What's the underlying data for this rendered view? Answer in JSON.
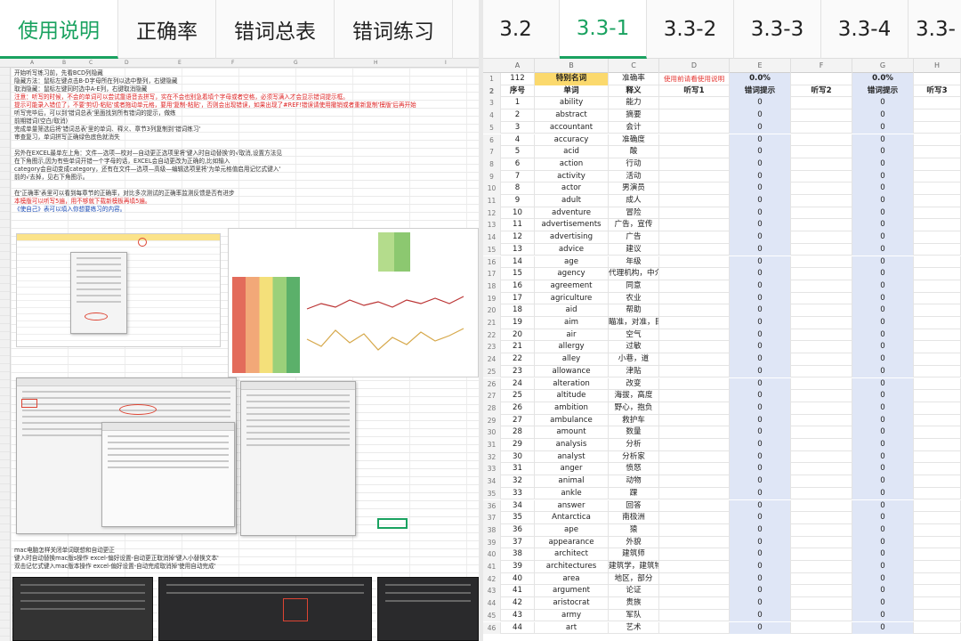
{
  "left_tabs": [
    "使用说明",
    "正确率",
    "错词总表",
    "错词练习"
  ],
  "left_active_tab": 0,
  "left_col_headers": [
    "A",
    "B",
    "C",
    "D",
    "E",
    "F",
    "G",
    "H",
    "I"
  ],
  "instructions": [
    {
      "text": "开始听写练习前，先看BCD列隐藏",
      "color": "normal"
    },
    {
      "text": "隐藏方法：鼠标左键点击B-D字母所在列以选中整列，右键隐藏",
      "color": "normal"
    },
    {
      "text": "取消隐藏：鼠标左键同时选中A-E列，右键取消隐藏",
      "color": "normal"
    },
    {
      "text": "注意：听写的时候，不会的单词可以尝试靠语音去拼写，实在不会也别急着填个字母或者空格，必须写满入才会显示错词提示框。",
      "color": "red"
    },
    {
      "text": "提示可能录入错位了，不要'剪切-粘贴'或者拖动单元格，要用'复制-粘贴'，否则会出现错误，如果出现了#REF!错误请使用撤销或者重新复制'模版'后再开始",
      "color": "red"
    },
    {
      "text": "听写完毕后，可以到'错词总表'里面找到所有错词的提示，做练",
      "color": "normal"
    },
    {
      "text": "前期错词(空白/取消)",
      "color": "normal"
    },
    {
      "text": "完成单量筛选后将'错词总表'里的单词、释义、章节3列复制到'错词练习'",
      "color": "normal"
    },
    {
      "text": "审查复习，单词拼写正确绿色底色就消失",
      "color": "normal"
    },
    {
      "text": "",
      "color": "normal"
    },
    {
      "text": "另外在EXCEL最单左上角：文件—选项—校对—自动更正选项里将'键入时自动替换'的√取消,设置方法见",
      "color": "normal"
    },
    {
      "text": "在下角图示,因为有些单词开错一个字母的话，EXCEL会自动更改为正确的,比如输入",
      "color": "normal"
    },
    {
      "text": "category会自动变成category，还有在文件—选项—高级—编辑选项里将'为单元格值启用记忆式键入'",
      "color": "normal"
    },
    {
      "text": "前的√去掉，见右下角图示。",
      "color": "normal"
    },
    {
      "text": "",
      "color": "normal"
    },
    {
      "text": "在'正确率'表里可以看到每章节的正确率，对比多次测试的正确率监测反馈是否有进步",
      "color": "normal"
    },
    {
      "text": "本模版可以听写5遍，用不够就下载新模板再填5遍。",
      "color": "red"
    },
    {
      "text": "《使自己》表可以填入你想要练习的内容。",
      "color": "blue"
    }
  ],
  "bottom_notes": [
    "mac电脑怎样关闭单词联想和自动更正",
    "键入时自动替换mac版s操作 excel-偏好设置-自动更正取消掉'键入小替换文本'",
    "双击记忆式键入mac版本操作 excel-偏好设置-自动完成取消掉'使用自动完成'"
  ],
  "right_tabs": [
    "3.2",
    "3.3-1",
    "3.3-2",
    "3.3-3",
    "3.3-4",
    "3.3-"
  ],
  "right_active_tab": 1,
  "right_col_headers": [
    "A",
    "B",
    "C",
    "D",
    "E",
    "F",
    "G",
    "H"
  ],
  "sheet_header": {
    "row1": {
      "a": "112",
      "b": "特别名词",
      "c": "准确率",
      "d": "使用前请看使用说明",
      "e": "0.0%",
      "g": "0.0%"
    },
    "row2": {
      "a": "序号",
      "b": "单词",
      "c": "释义",
      "d": "听写1",
      "e": "错词提示",
      "f": "听写2",
      "g": "错词提示",
      "h": "听写3"
    }
  },
  "words": [
    [
      "ability",
      "能力"
    ],
    [
      "abstract",
      "摘要"
    ],
    [
      "accountant",
      "会计"
    ],
    [
      "accuracy",
      "准确度"
    ],
    [
      "acid",
      "酸"
    ],
    [
      "action",
      "行动"
    ],
    [
      "activity",
      "活动"
    ],
    [
      "actor",
      "男演员"
    ],
    [
      "adult",
      "成人"
    ],
    [
      "adventure",
      "冒险"
    ],
    [
      "advertisements",
      "广告，宣传"
    ],
    [
      "advertising",
      "广告"
    ],
    [
      "advice",
      "建议"
    ],
    [
      "age",
      "年级"
    ],
    [
      "agency",
      "代理机构，中介"
    ],
    [
      "agreement",
      "同意"
    ],
    [
      "agriculture",
      "农业"
    ],
    [
      "aid",
      "帮助"
    ],
    [
      "aim",
      "瞄准，对准，目的"
    ],
    [
      "air",
      "空气"
    ],
    [
      "allergy",
      "过敏"
    ],
    [
      "alley",
      "小巷，道"
    ],
    [
      "allowance",
      "津贴"
    ],
    [
      "alteration",
      "改变"
    ],
    [
      "altitude",
      "海拔，高度"
    ],
    [
      "ambition",
      "野心，抱负"
    ],
    [
      "ambulance",
      "救护车"
    ],
    [
      "amount",
      "数量"
    ],
    [
      "analysis",
      "分析"
    ],
    [
      "analyst",
      "分析家"
    ],
    [
      "anger",
      "愤怒"
    ],
    [
      "animal",
      "动物"
    ],
    [
      "ankle",
      "踝"
    ],
    [
      "answer",
      "回答"
    ],
    [
      "Antarctica",
      "南极洲"
    ],
    [
      "ape",
      "猿"
    ],
    [
      "appearance",
      "外貌"
    ],
    [
      "architect",
      "建筑师"
    ],
    [
      "architectures",
      "建筑学，建筑物"
    ],
    [
      "area",
      "地区，部分"
    ],
    [
      "argument",
      "论证"
    ],
    [
      "aristocrat",
      "贵族"
    ],
    [
      "army",
      "军队"
    ],
    [
      "art",
      "艺术"
    ]
  ],
  "hint_value": "0",
  "colors": {
    "accent_green": "#1aa260",
    "header_yellow": "#fbd96d",
    "hint_blue": "#dfe6f6",
    "warn_red": "#e53935"
  }
}
